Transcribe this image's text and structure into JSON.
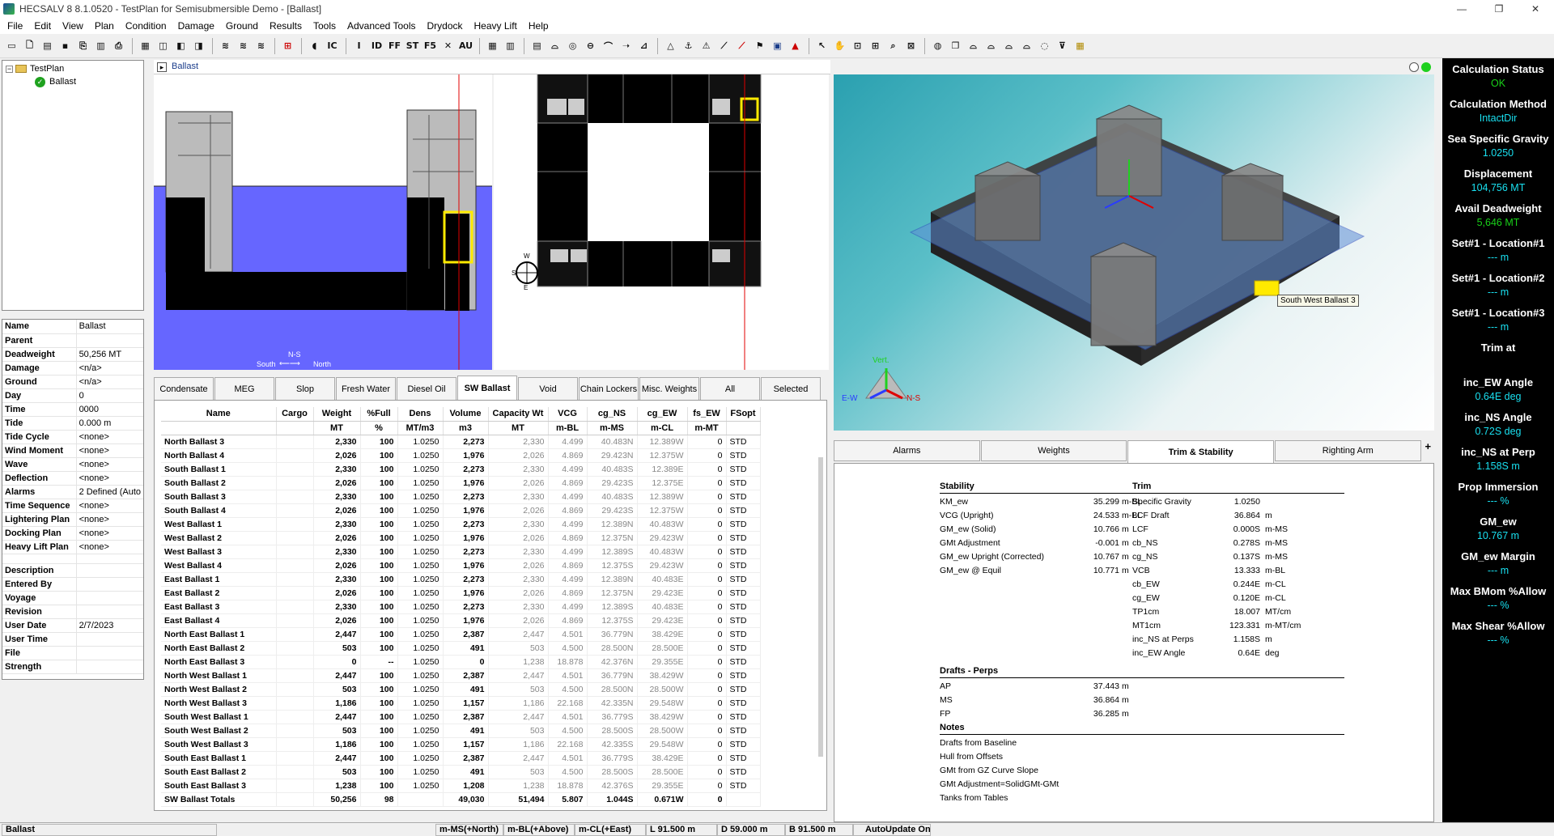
{
  "window": {
    "title": "HECSALV 8 8.1.0520 - TestPlan for Semisubmersible Demo - [Ballast]",
    "minimize": "—",
    "maximize": "❐",
    "close": "✕"
  },
  "menu": [
    "File",
    "Edit",
    "View",
    "Plan",
    "Condition",
    "Damage",
    "Ground",
    "Results",
    "Tools",
    "Advanced Tools",
    "Drydock",
    "Heavy Lift",
    "Help"
  ],
  "toolbar": {
    "text_buttons": [
      "IC",
      "I",
      "ID",
      "FF",
      "ST",
      "F5",
      "AU"
    ]
  },
  "tree": {
    "root": "TestPlan",
    "child": "Ballast"
  },
  "props": [
    [
      "Name",
      "Ballast"
    ],
    [
      "Parent",
      ""
    ],
    [
      "Deadweight",
      "50,256 MT"
    ],
    [
      "Damage",
      "<n/a>"
    ],
    [
      "Ground",
      "<n/a>"
    ],
    [
      "Day",
      "0"
    ],
    [
      "Time",
      "0000"
    ],
    [
      "Tide",
      "0.000 m"
    ],
    [
      "Tide Cycle",
      "<none>"
    ],
    [
      "Wind Moment",
      "<none>"
    ],
    [
      "Wave",
      "<none>"
    ],
    [
      "Deflection",
      "<none>"
    ],
    [
      "Alarms",
      "2 Defined (Auto"
    ],
    [
      "Time Sequence",
      "<none>"
    ],
    [
      "Lightering Plan",
      "<none>"
    ],
    [
      "Docking Plan",
      "<none>"
    ],
    [
      "Heavy Lift Plan",
      "<none>"
    ],
    [
      "",
      ""
    ],
    [
      "Description",
      ""
    ],
    [
      "Entered By",
      ""
    ],
    [
      "Voyage",
      ""
    ],
    [
      "Revision",
      ""
    ],
    [
      "User Date",
      "2/7/2023"
    ],
    [
      "User Time",
      ""
    ],
    [
      "File",
      ""
    ],
    [
      "Strength",
      ""
    ]
  ],
  "view_header": "Ballast",
  "elevation": {
    "axis": "N-S",
    "south": "South",
    "north": "North"
  },
  "compass": {
    "n": "N",
    "s": "S",
    "e": "E",
    "w": "W"
  },
  "view3d": {
    "tooltip": "South West Ballast 3",
    "axis_vert": "Vert.",
    "axis_ew": "E-W",
    "axis_ns": "N-S"
  },
  "tabs": [
    "Condensate",
    "MEG",
    "Slop",
    "Fresh Water",
    "Diesel Oil",
    "SW Ballast",
    "Void",
    "Chain Lockers",
    "Misc. Weights",
    "All",
    "Selected"
  ],
  "active_tab": "SW Ballast",
  "grid": {
    "headers": [
      "Name",
      "Cargo",
      "Weight",
      "%Full",
      "Dens",
      "Volume",
      "Capacity Wt",
      "VCG",
      "cg_NS",
      "cg_EW",
      "fs_EW",
      "FSopt"
    ],
    "units": [
      "",
      "",
      "MT",
      "%",
      "MT/m3",
      "m3",
      "MT",
      "m-BL",
      "m-MS",
      "m-CL",
      "m-MT",
      ""
    ],
    "rows": [
      [
        "North Ballast 3",
        "",
        "2,330",
        "100",
        "1.0250",
        "2,273",
        "2,330",
        "4.499",
        "40.483N",
        "12.389W",
        "0",
        "STD"
      ],
      [
        "North Ballast 4",
        "",
        "2,026",
        "100",
        "1.0250",
        "1,976",
        "2,026",
        "4.869",
        "29.423N",
        "12.375W",
        "0",
        "STD"
      ],
      [
        "South Ballast 1",
        "",
        "2,330",
        "100",
        "1.0250",
        "2,273",
        "2,330",
        "4.499",
        "40.483S",
        "12.389E",
        "0",
        "STD"
      ],
      [
        "South Ballast 2",
        "",
        "2,026",
        "100",
        "1.0250",
        "1,976",
        "2,026",
        "4.869",
        "29.423S",
        "12.375E",
        "0",
        "STD"
      ],
      [
        "South Ballast 3",
        "",
        "2,330",
        "100",
        "1.0250",
        "2,273",
        "2,330",
        "4.499",
        "40.483S",
        "12.389W",
        "0",
        "STD"
      ],
      [
        "South Ballast 4",
        "",
        "2,026",
        "100",
        "1.0250",
        "1,976",
        "2,026",
        "4.869",
        "29.423S",
        "12.375W",
        "0",
        "STD"
      ],
      [
        "West Ballast 1",
        "",
        "2,330",
        "100",
        "1.0250",
        "2,273",
        "2,330",
        "4.499",
        "12.389N",
        "40.483W",
        "0",
        "STD"
      ],
      [
        "West Ballast 2",
        "",
        "2,026",
        "100",
        "1.0250",
        "1,976",
        "2,026",
        "4.869",
        "12.375N",
        "29.423W",
        "0",
        "STD"
      ],
      [
        "West Ballast 3",
        "",
        "2,330",
        "100",
        "1.0250",
        "2,273",
        "2,330",
        "4.499",
        "12.389S",
        "40.483W",
        "0",
        "STD"
      ],
      [
        "West Ballast 4",
        "",
        "2,026",
        "100",
        "1.0250",
        "1,976",
        "2,026",
        "4.869",
        "12.375S",
        "29.423W",
        "0",
        "STD"
      ],
      [
        "East Ballast 1",
        "",
        "2,330",
        "100",
        "1.0250",
        "2,273",
        "2,330",
        "4.499",
        "12.389N",
        "40.483E",
        "0",
        "STD"
      ],
      [
        "East Ballast 2",
        "",
        "2,026",
        "100",
        "1.0250",
        "1,976",
        "2,026",
        "4.869",
        "12.375N",
        "29.423E",
        "0",
        "STD"
      ],
      [
        "East Ballast 3",
        "",
        "2,330",
        "100",
        "1.0250",
        "2,273",
        "2,330",
        "4.499",
        "12.389S",
        "40.483E",
        "0",
        "STD"
      ],
      [
        "East Ballast 4",
        "",
        "2,026",
        "100",
        "1.0250",
        "1,976",
        "2,026",
        "4.869",
        "12.375S",
        "29.423E",
        "0",
        "STD"
      ],
      [
        "North East Ballast 1",
        "",
        "2,447",
        "100",
        "1.0250",
        "2,387",
        "2,447",
        "4.501",
        "36.779N",
        "38.429E",
        "0",
        "STD"
      ],
      [
        "North East Ballast 2",
        "",
        "503",
        "100",
        "1.0250",
        "491",
        "503",
        "4.500",
        "28.500N",
        "28.500E",
        "0",
        "STD"
      ],
      [
        "North East Ballast 3",
        "",
        "0",
        "--",
        "1.0250",
        "0",
        "1,238",
        "18.878",
        "42.376N",
        "29.355E",
        "0",
        "STD"
      ],
      [
        "North West Ballast 1",
        "",
        "2,447",
        "100",
        "1.0250",
        "2,387",
        "2,447",
        "4.501",
        "36.779N",
        "38.429W",
        "0",
        "STD"
      ],
      [
        "North West Ballast 2",
        "",
        "503",
        "100",
        "1.0250",
        "491",
        "503",
        "4.500",
        "28.500N",
        "28.500W",
        "0",
        "STD"
      ],
      [
        "North West Ballast 3",
        "",
        "1,186",
        "100",
        "1.0250",
        "1,157",
        "1,186",
        "22.168",
        "42.335N",
        "29.548W",
        "0",
        "STD"
      ],
      [
        "South West Ballast 1",
        "",
        "2,447",
        "100",
        "1.0250",
        "2,387",
        "2,447",
        "4.501",
        "36.779S",
        "38.429W",
        "0",
        "STD"
      ],
      [
        "South West Ballast 2",
        "",
        "503",
        "100",
        "1.0250",
        "491",
        "503",
        "4.500",
        "28.500S",
        "28.500W",
        "0",
        "STD"
      ],
      [
        "South West Ballast 3",
        "",
        "1,186",
        "100",
        "1.0250",
        "1,157",
        "1,186",
        "22.168",
        "42.335S",
        "29.548W",
        "0",
        "STD"
      ],
      [
        "South East Ballast 1",
        "",
        "2,447",
        "100",
        "1.0250",
        "2,387",
        "2,447",
        "4.501",
        "36.779S",
        "38.429E",
        "0",
        "STD"
      ],
      [
        "South East Ballast 2",
        "",
        "503",
        "100",
        "1.0250",
        "491",
        "503",
        "4.500",
        "28.500S",
        "28.500E",
        "0",
        "STD"
      ],
      [
        "South East Ballast 3",
        "",
        "1,238",
        "100",
        "1.0250",
        "1,208",
        "1,238",
        "18.878",
        "42.376S",
        "29.355E",
        "0",
        "STD"
      ]
    ],
    "totals": [
      "SW Ballast Totals",
      "",
      "50,256",
      "98",
      "",
      "49,030",
      "51,494",
      "5.807",
      "1.044S",
      "0.671W",
      "0",
      ""
    ]
  },
  "result_tabs": [
    "Alarms",
    "Weights",
    "Trim & Stability",
    "Righting Arm"
  ],
  "result_tab_plus": "+",
  "active_result_tab": "Trim & Stability",
  "stability": {
    "title": "Stability",
    "rows": [
      [
        "KM_ew",
        "35.299",
        "m-BL"
      ],
      [
        "VCG (Upright)",
        "24.533",
        "m-BL"
      ],
      [
        "GM_ew (Solid)",
        "10.766",
        "m"
      ],
      [
        "GMt Adjustment",
        "-0.001",
        "m"
      ],
      [
        "GM_ew Upright (Corrected)",
        "10.767",
        "m"
      ],
      [
        "GM_ew @ Equil",
        "10.771",
        "m"
      ]
    ]
  },
  "trim": {
    "title": "Trim",
    "rows": [
      [
        "Specific Gravity",
        "1.0250",
        ""
      ],
      [
        "LCF Draft",
        "36.864",
        "m"
      ],
      [
        "LCF",
        "0.000S",
        "m-MS"
      ],
      [
        "cb_NS",
        "0.278S",
        "m-MS"
      ],
      [
        "cg_NS",
        "0.137S",
        "m-MS"
      ],
      [
        "VCB",
        "13.333",
        "m-BL"
      ],
      [
        "cb_EW",
        "0.244E",
        "m-CL"
      ],
      [
        "cg_EW",
        "0.120E",
        "m-CL"
      ],
      [
        "TP1cm",
        "18.007",
        "MT/cm"
      ],
      [
        "MT1cm",
        "123.331",
        "m-MT/cm"
      ],
      [
        "inc_NS at Perps",
        "1.158S",
        "m"
      ],
      [
        "inc_EW Angle",
        "0.64E",
        "deg"
      ]
    ]
  },
  "drafts": {
    "title": "Drafts - Perps",
    "rows": [
      [
        "AP",
        "37.443",
        "m"
      ],
      [
        "MS",
        "36.864",
        "m"
      ],
      [
        "FP",
        "36.285",
        "m"
      ]
    ]
  },
  "notes": {
    "title": "Notes",
    "rows": [
      "Drafts from Baseline",
      "Hull from Offsets",
      "GMt from GZ Curve Slope",
      "GMt Adjustment=SolidGMt-GMt",
      "Tanks from Tables"
    ]
  },
  "right_panel": [
    [
      "Calculation Status",
      "OK"
    ],
    [
      "Calculation Method",
      "IntactDir"
    ],
    [
      "Sea Specific Gravity",
      "1.0250"
    ],
    [
      "Displacement",
      "104,756 MT"
    ],
    [
      "Avail Deadweight",
      "5,646 MT"
    ],
    [
      "Set#1 - Location#1",
      "--- m"
    ],
    [
      "Set#1 - Location#2",
      "--- m"
    ],
    [
      "Set#1 - Location#3",
      "--- m"
    ],
    [
      "Trim at",
      ""
    ],
    [
      "inc_EW Angle",
      "0.64E deg"
    ],
    [
      "inc_NS Angle",
      "0.72S deg"
    ],
    [
      "inc_NS at Perp",
      "1.158S m"
    ],
    [
      "Prop Immersion",
      "--- %"
    ],
    [
      "GM_ew",
      "10.767 m"
    ],
    [
      "GM_ew Margin",
      "--- m"
    ],
    [
      "Max BMom %Allow",
      "--- %"
    ],
    [
      "Max Shear %Allow",
      "--- %"
    ]
  ],
  "status": [
    "Ballast",
    "m-MS(+North)",
    "m-BL(+Above)",
    "m-CL(+East)",
    "L 91.500 m",
    "D 59.000 m",
    "B 91.500 m",
    "AutoUpdate On"
  ],
  "colors": {
    "water": "#6666ff",
    "highlight": "#ffea00",
    "status_ok": "#19d019",
    "value_cyan": "#19e0f0",
    "link": "#1a3c8a"
  }
}
